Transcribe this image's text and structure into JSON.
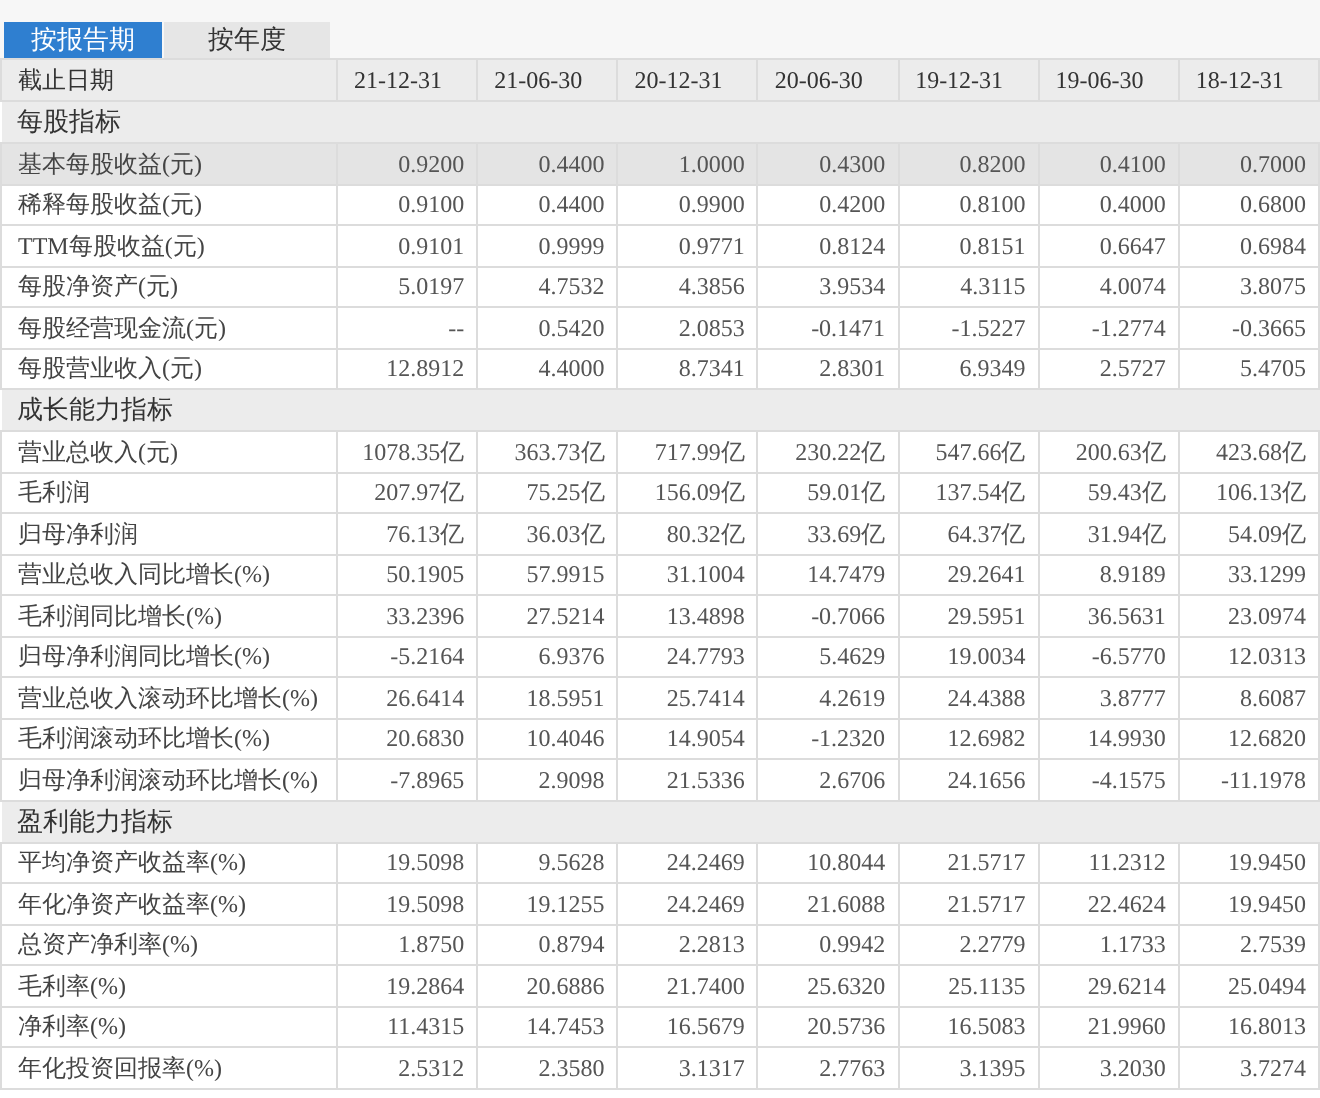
{
  "tabs": [
    {
      "label": "按报告期",
      "selected": true
    },
    {
      "label": "按年度",
      "selected": false
    }
  ],
  "table": {
    "columns": [
      "截止日期",
      "21-12-31",
      "21-06-30",
      "20-12-31",
      "20-06-30",
      "19-12-31",
      "19-06-30",
      "18-12-31"
    ],
    "sections": [
      {
        "title": "每股指标",
        "rows": [
          {
            "label": "基本每股收益(元)",
            "values": [
              "0.9200",
              "0.4400",
              "1.0000",
              "0.4300",
              "0.8200",
              "0.4100",
              "0.7000"
            ],
            "highlighted": true
          },
          {
            "label": "稀释每股收益(元)",
            "values": [
              "0.9100",
              "0.4400",
              "0.9900",
              "0.4200",
              "0.8100",
              "0.4000",
              "0.6800"
            ],
            "highlighted": false
          },
          {
            "label": "TTM每股收益(元)",
            "values": [
              "0.9101",
              "0.9999",
              "0.9771",
              "0.8124",
              "0.8151",
              "0.6647",
              "0.6984"
            ],
            "highlighted": false
          },
          {
            "label": "每股净资产(元)",
            "values": [
              "5.0197",
              "4.7532",
              "4.3856",
              "3.9534",
              "4.3115",
              "4.0074",
              "3.8075"
            ],
            "highlighted": false
          },
          {
            "label": "每股经营现金流(元)",
            "values": [
              "--",
              "0.5420",
              "2.0853",
              "-0.1471",
              "-1.5227",
              "-1.2774",
              "-0.3665"
            ],
            "highlighted": false
          },
          {
            "label": "每股营业收入(元)",
            "values": [
              "12.8912",
              "4.4000",
              "8.7341",
              "2.8301",
              "6.9349",
              "2.5727",
              "5.4705"
            ],
            "highlighted": false
          }
        ]
      },
      {
        "title": "成长能力指标",
        "rows": [
          {
            "label": "营业总收入(元)",
            "values": [
              "1078.35亿",
              "363.73亿",
              "717.99亿",
              "230.22亿",
              "547.66亿",
              "200.63亿",
              "423.68亿"
            ],
            "highlighted": false
          },
          {
            "label": "毛利润",
            "values": [
              "207.97亿",
              "75.25亿",
              "156.09亿",
              "59.01亿",
              "137.54亿",
              "59.43亿",
              "106.13亿"
            ],
            "highlighted": false
          },
          {
            "label": "归母净利润",
            "values": [
              "76.13亿",
              "36.03亿",
              "80.32亿",
              "33.69亿",
              "64.37亿",
              "31.94亿",
              "54.09亿"
            ],
            "highlighted": false
          },
          {
            "label": "营业总收入同比增长(%)",
            "values": [
              "50.1905",
              "57.9915",
              "31.1004",
              "14.7479",
              "29.2641",
              "8.9189",
              "33.1299"
            ],
            "highlighted": false
          },
          {
            "label": "毛利润同比增长(%)",
            "values": [
              "33.2396",
              "27.5214",
              "13.4898",
              "-0.7066",
              "29.5951",
              "36.5631",
              "23.0974"
            ],
            "highlighted": false
          },
          {
            "label": "归母净利润同比增长(%)",
            "values": [
              "-5.2164",
              "6.9376",
              "24.7793",
              "5.4629",
              "19.0034",
              "-6.5770",
              "12.0313"
            ],
            "highlighted": false
          },
          {
            "label": "营业总收入滚动环比增长(%)",
            "values": [
              "26.6414",
              "18.5951",
              "25.7414",
              "4.2619",
              "24.4388",
              "3.8777",
              "8.6087"
            ],
            "highlighted": false
          },
          {
            "label": "毛利润滚动环比增长(%)",
            "values": [
              "20.6830",
              "10.4046",
              "14.9054",
              "-1.2320",
              "12.6982",
              "14.9930",
              "12.6820"
            ],
            "highlighted": false
          },
          {
            "label": "归母净利润滚动环比增长(%)",
            "values": [
              "-7.8965",
              "2.9098",
              "21.5336",
              "2.6706",
              "24.1656",
              "-4.1575",
              "-11.1978"
            ],
            "highlighted": false
          }
        ]
      },
      {
        "title": "盈利能力指标",
        "rows": [
          {
            "label": "平均净资产收益率(%)",
            "values": [
              "19.5098",
              "9.5628",
              "24.2469",
              "10.8044",
              "21.5717",
              "11.2312",
              "19.9450"
            ],
            "highlighted": false
          },
          {
            "label": "年化净资产收益率(%)",
            "values": [
              "19.5098",
              "19.1255",
              "24.2469",
              "21.6088",
              "21.5717",
              "22.4624",
              "19.9450"
            ],
            "highlighted": false
          },
          {
            "label": "总资产净利率(%)",
            "values": [
              "1.8750",
              "0.8794",
              "2.2813",
              "0.9942",
              "2.2779",
              "1.1733",
              "2.7539"
            ],
            "highlighted": false
          },
          {
            "label": "毛利率(%)",
            "values": [
              "19.2864",
              "20.6886",
              "21.7400",
              "25.6320",
              "25.1135",
              "29.6214",
              "25.0494"
            ],
            "highlighted": false
          },
          {
            "label": "净利率(%)",
            "values": [
              "11.4315",
              "14.7453",
              "16.5679",
              "20.5736",
              "16.5083",
              "21.9960",
              "16.8013"
            ],
            "highlighted": false
          },
          {
            "label": "年化投资回报率(%)",
            "values": [
              "2.5312",
              "2.3580",
              "3.1317",
              "2.7763",
              "3.1395",
              "3.2030",
              "3.7274"
            ],
            "highlighted": false
          }
        ]
      }
    ]
  }
}
